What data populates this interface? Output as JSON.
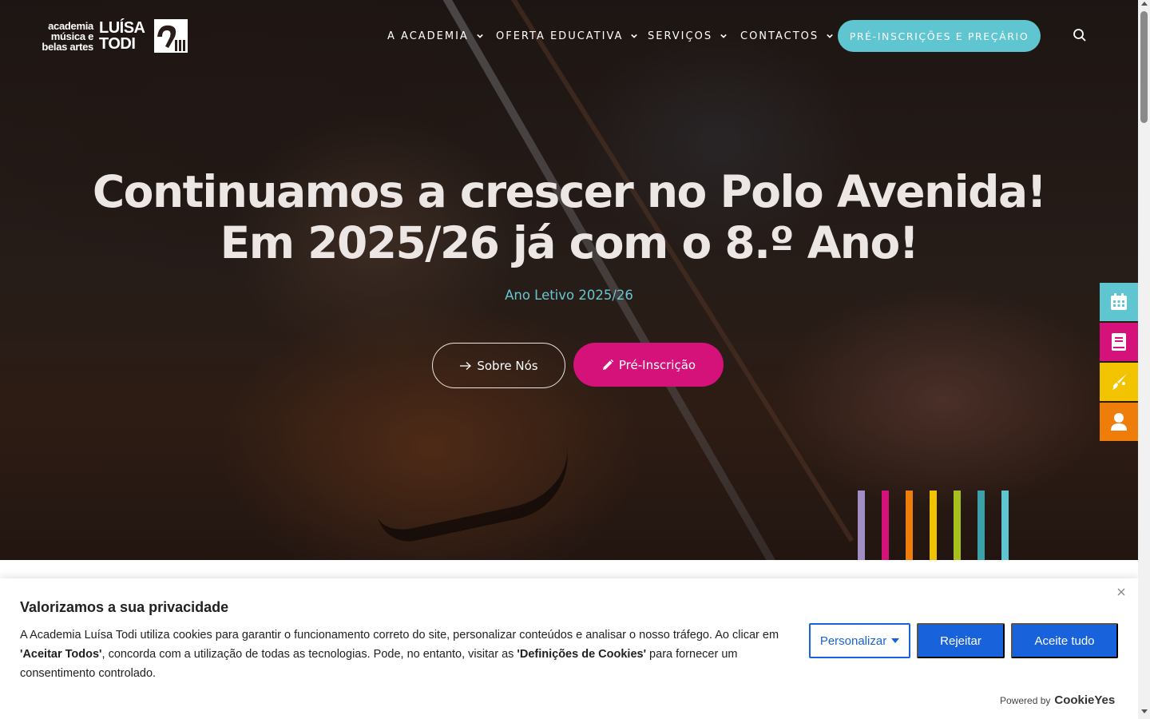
{
  "header": {
    "logo": {
      "line1": "academia",
      "line2": "música e",
      "line3": "belas artes",
      "name1": "LUÍSA",
      "name2": "TODI"
    },
    "nav": [
      {
        "label": "A ACADEMIA",
        "icon": "chevron-down-icon"
      },
      {
        "label": "OFERTA EDUCATIVA",
        "icon": "chevron-down-icon"
      },
      {
        "label": "SERVIÇOS",
        "icon": "chevron-down-icon"
      },
      {
        "label": "CONTACTOS",
        "icon": "chevron-down-icon"
      }
    ],
    "cta_label": "PRÉ-INSCRIÇÕES E PREÇÁRIO",
    "search_icon": "search-icon"
  },
  "hero": {
    "headline_line1": "Continuamos a crescer no Polo Avenida!",
    "headline_line2": "Em 2025/26 já com o 8.º Ano!",
    "subline": "Ano Letivo 2025/26",
    "about_label": "Sobre Nós",
    "preinscription_label": "Pré-Inscrição"
  },
  "side_widgets": [
    {
      "icon": "calendar-icon",
      "color": "#5ec5d1"
    },
    {
      "icon": "book-icon",
      "color": "#d5117a"
    },
    {
      "icon": "paintbrush-icon",
      "color": "#f2c400"
    },
    {
      "icon": "user-icon",
      "color": "#ee7d0a"
    }
  ],
  "color_bars": [
    "#a08ec4",
    "#d5117a",
    "#ee7d0a",
    "#f2c400",
    "#a6c11b",
    "#3aa1aa",
    "#5ec5d1"
  ],
  "cookie": {
    "title": "Valorizamos a sua privacidade",
    "text_part1": "A Academia Luísa Todi utiliza cookies para garantir o funcionamento correto do site, personalizar conteúdos e analisar o nosso tráfego. Ao clicar em ",
    "text_bold1": "'Aceitar Todos'",
    "text_part2": ", concorda com a utilização de todas as tecnologias. Pode, no entanto, visitar as ",
    "text_bold2": "'Definições de Cookies'",
    "text_part3": " para fornecer um consentimento controlado.",
    "personalize_label": "Personalizar",
    "reject_label": "Rejeitar",
    "accept_label": "Aceite tudo",
    "powered_by": "Powered by",
    "powered_brand": "CookieYes",
    "accent": "#1863dc"
  }
}
